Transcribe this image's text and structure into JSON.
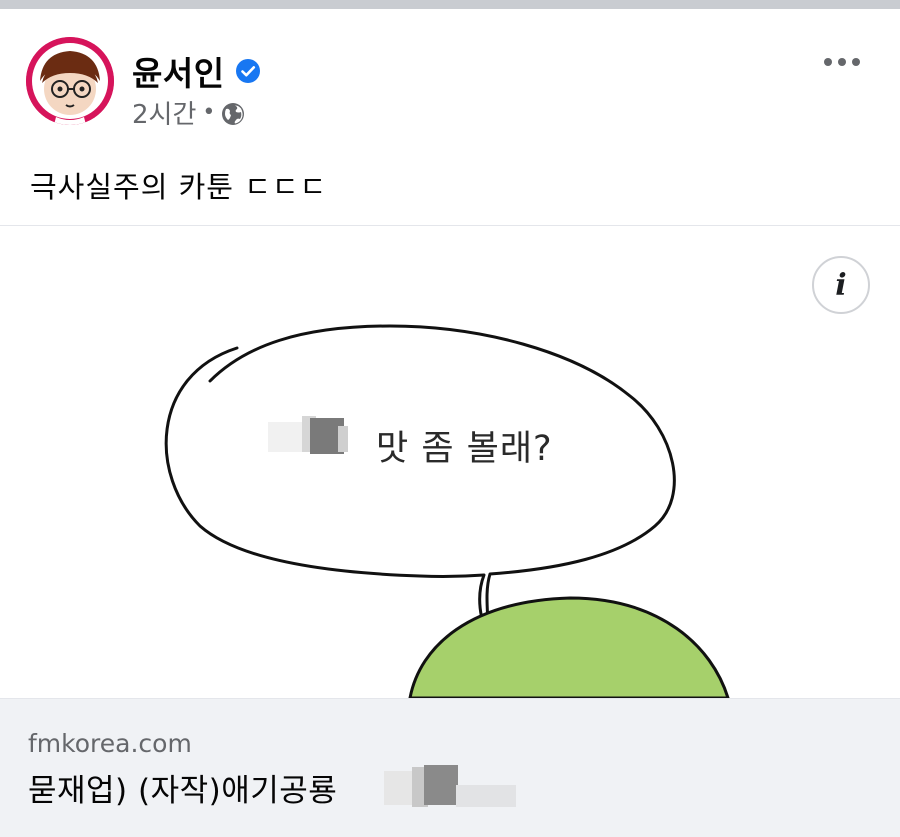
{
  "post": {
    "author": "윤서인",
    "verified_icon": "verified-badge-icon",
    "time": "2시간",
    "separator": "•",
    "audience_icon": "globe-icon",
    "more_icon": "more-options-icon",
    "caption": "극사실주의 카툰 ㄷㄷㄷ"
  },
  "image": {
    "info_label": "i",
    "bubble_text": "맛 좀 볼래?",
    "colors": {
      "character": "#a6d06b",
      "outline": "#111111"
    }
  },
  "link": {
    "domain": "fmkorea.com",
    "title": "묻재업) (자작)애기공룡"
  },
  "colors": {
    "accent": "#1877f2",
    "secondary_text": "#65676b",
    "avatar_bg": "#d6145b"
  }
}
